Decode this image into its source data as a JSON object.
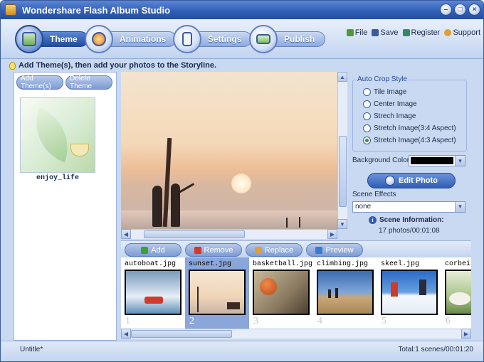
{
  "window": {
    "title": "Wondershare Flash Album Studio",
    "controls": [
      "minimize",
      "maximize",
      "close"
    ]
  },
  "toolbar": {
    "tabs": [
      {
        "label": "Theme",
        "active": true,
        "icon": "theme-icon"
      },
      {
        "label": "Animations",
        "active": false,
        "icon": "animations-icon"
      },
      {
        "label": "Settings",
        "active": false,
        "icon": "settings-icon"
      },
      {
        "label": "Publish",
        "active": false,
        "icon": "publish-icon"
      }
    ],
    "links": [
      {
        "label": "File",
        "icon": "file-icon"
      },
      {
        "label": "Save",
        "icon": "save-icon"
      },
      {
        "label": "Register",
        "icon": "register-icon"
      },
      {
        "label": "Support",
        "icon": "support-icon"
      }
    ]
  },
  "hint": "Add Theme(s), then add your photos to the Storyline.",
  "theme_panel": {
    "buttons": [
      "Add Theme(s)",
      "Delete Theme"
    ],
    "themes": [
      {
        "name": "enjoy_life"
      }
    ]
  },
  "crop_style": {
    "title": "Auto Crop Style",
    "options": [
      {
        "label": "Tile Image",
        "checked": false
      },
      {
        "label": "Center Image",
        "checked": false
      },
      {
        "label": "Strech Image",
        "checked": false
      },
      {
        "label": "Stretch Image(3:4 Aspect)",
        "checked": false
      },
      {
        "label": "Stretch Image(4:3 Aspect)",
        "checked": true
      }
    ]
  },
  "background_color": {
    "label": "Background Color",
    "value": "#000000"
  },
  "edit_photo_label": "Edit Photo",
  "scene_effects": {
    "label": "Scene Effects",
    "value": "none"
  },
  "scene_info": {
    "title": "Scene Information:",
    "value": "17 photos/00:01:08"
  },
  "story_actions": [
    {
      "label": "Add",
      "icon": "plus-icon"
    },
    {
      "label": "Remove",
      "icon": "minus-icon"
    },
    {
      "label": "Replace",
      "icon": "replace-icon"
    },
    {
      "label": "Preview",
      "icon": "preview-icon"
    }
  ],
  "storyline": [
    {
      "name": "autoboat.jpg",
      "num": "1",
      "selected": false
    },
    {
      "name": "sunset.jpg",
      "num": "2",
      "selected": true
    },
    {
      "name": "basketball.jpg",
      "num": "3",
      "selected": false
    },
    {
      "name": "climbing.jpg",
      "num": "4",
      "selected": false
    },
    {
      "name": "skeel.jpg",
      "num": "5",
      "selected": false
    },
    {
      "name": "corbeil",
      "num": "6",
      "selected": false
    }
  ],
  "status": {
    "left": "Untitle*",
    "right": "Total:1 scenes/00:01:20"
  }
}
